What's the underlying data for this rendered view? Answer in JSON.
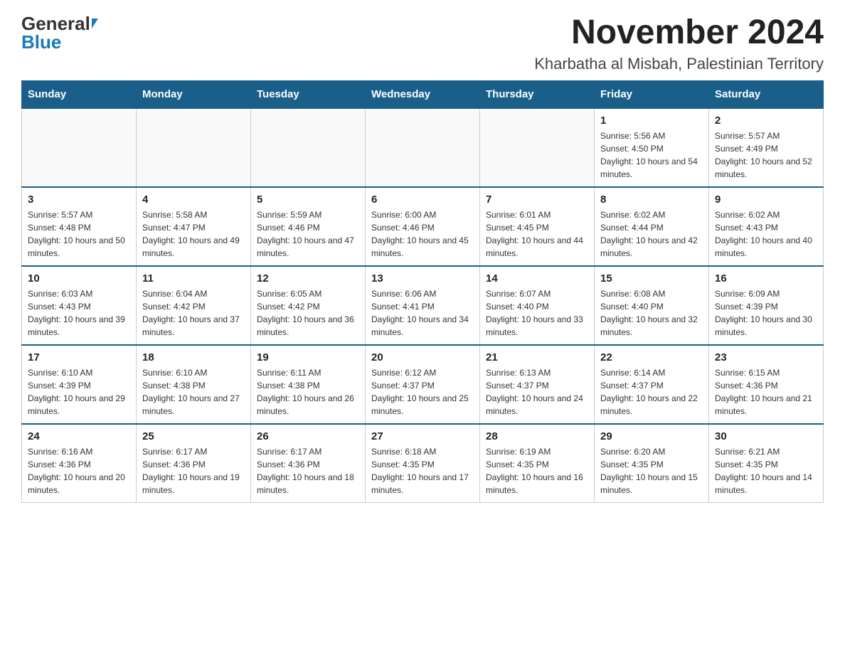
{
  "header": {
    "logo_general": "General",
    "logo_blue": "Blue",
    "title": "November 2024",
    "subtitle": "Kharbatha al Misbah, Palestinian Territory"
  },
  "calendar": {
    "days_of_week": [
      "Sunday",
      "Monday",
      "Tuesday",
      "Wednesday",
      "Thursday",
      "Friday",
      "Saturday"
    ],
    "weeks": [
      [
        {
          "day": "",
          "info": ""
        },
        {
          "day": "",
          "info": ""
        },
        {
          "day": "",
          "info": ""
        },
        {
          "day": "",
          "info": ""
        },
        {
          "day": "",
          "info": ""
        },
        {
          "day": "1",
          "info": "Sunrise: 5:56 AM\nSunset: 4:50 PM\nDaylight: 10 hours and 54 minutes."
        },
        {
          "day": "2",
          "info": "Sunrise: 5:57 AM\nSunset: 4:49 PM\nDaylight: 10 hours and 52 minutes."
        }
      ],
      [
        {
          "day": "3",
          "info": "Sunrise: 5:57 AM\nSunset: 4:48 PM\nDaylight: 10 hours and 50 minutes."
        },
        {
          "day": "4",
          "info": "Sunrise: 5:58 AM\nSunset: 4:47 PM\nDaylight: 10 hours and 49 minutes."
        },
        {
          "day": "5",
          "info": "Sunrise: 5:59 AM\nSunset: 4:46 PM\nDaylight: 10 hours and 47 minutes."
        },
        {
          "day": "6",
          "info": "Sunrise: 6:00 AM\nSunset: 4:46 PM\nDaylight: 10 hours and 45 minutes."
        },
        {
          "day": "7",
          "info": "Sunrise: 6:01 AM\nSunset: 4:45 PM\nDaylight: 10 hours and 44 minutes."
        },
        {
          "day": "8",
          "info": "Sunrise: 6:02 AM\nSunset: 4:44 PM\nDaylight: 10 hours and 42 minutes."
        },
        {
          "day": "9",
          "info": "Sunrise: 6:02 AM\nSunset: 4:43 PM\nDaylight: 10 hours and 40 minutes."
        }
      ],
      [
        {
          "day": "10",
          "info": "Sunrise: 6:03 AM\nSunset: 4:43 PM\nDaylight: 10 hours and 39 minutes."
        },
        {
          "day": "11",
          "info": "Sunrise: 6:04 AM\nSunset: 4:42 PM\nDaylight: 10 hours and 37 minutes."
        },
        {
          "day": "12",
          "info": "Sunrise: 6:05 AM\nSunset: 4:42 PM\nDaylight: 10 hours and 36 minutes."
        },
        {
          "day": "13",
          "info": "Sunrise: 6:06 AM\nSunset: 4:41 PM\nDaylight: 10 hours and 34 minutes."
        },
        {
          "day": "14",
          "info": "Sunrise: 6:07 AM\nSunset: 4:40 PM\nDaylight: 10 hours and 33 minutes."
        },
        {
          "day": "15",
          "info": "Sunrise: 6:08 AM\nSunset: 4:40 PM\nDaylight: 10 hours and 32 minutes."
        },
        {
          "day": "16",
          "info": "Sunrise: 6:09 AM\nSunset: 4:39 PM\nDaylight: 10 hours and 30 minutes."
        }
      ],
      [
        {
          "day": "17",
          "info": "Sunrise: 6:10 AM\nSunset: 4:39 PM\nDaylight: 10 hours and 29 minutes."
        },
        {
          "day": "18",
          "info": "Sunrise: 6:10 AM\nSunset: 4:38 PM\nDaylight: 10 hours and 27 minutes."
        },
        {
          "day": "19",
          "info": "Sunrise: 6:11 AM\nSunset: 4:38 PM\nDaylight: 10 hours and 26 minutes."
        },
        {
          "day": "20",
          "info": "Sunrise: 6:12 AM\nSunset: 4:37 PM\nDaylight: 10 hours and 25 minutes."
        },
        {
          "day": "21",
          "info": "Sunrise: 6:13 AM\nSunset: 4:37 PM\nDaylight: 10 hours and 24 minutes."
        },
        {
          "day": "22",
          "info": "Sunrise: 6:14 AM\nSunset: 4:37 PM\nDaylight: 10 hours and 22 minutes."
        },
        {
          "day": "23",
          "info": "Sunrise: 6:15 AM\nSunset: 4:36 PM\nDaylight: 10 hours and 21 minutes."
        }
      ],
      [
        {
          "day": "24",
          "info": "Sunrise: 6:16 AM\nSunset: 4:36 PM\nDaylight: 10 hours and 20 minutes."
        },
        {
          "day": "25",
          "info": "Sunrise: 6:17 AM\nSunset: 4:36 PM\nDaylight: 10 hours and 19 minutes."
        },
        {
          "day": "26",
          "info": "Sunrise: 6:17 AM\nSunset: 4:36 PM\nDaylight: 10 hours and 18 minutes."
        },
        {
          "day": "27",
          "info": "Sunrise: 6:18 AM\nSunset: 4:35 PM\nDaylight: 10 hours and 17 minutes."
        },
        {
          "day": "28",
          "info": "Sunrise: 6:19 AM\nSunset: 4:35 PM\nDaylight: 10 hours and 16 minutes."
        },
        {
          "day": "29",
          "info": "Sunrise: 6:20 AM\nSunset: 4:35 PM\nDaylight: 10 hours and 15 minutes."
        },
        {
          "day": "30",
          "info": "Sunrise: 6:21 AM\nSunset: 4:35 PM\nDaylight: 10 hours and 14 minutes."
        }
      ]
    ]
  }
}
